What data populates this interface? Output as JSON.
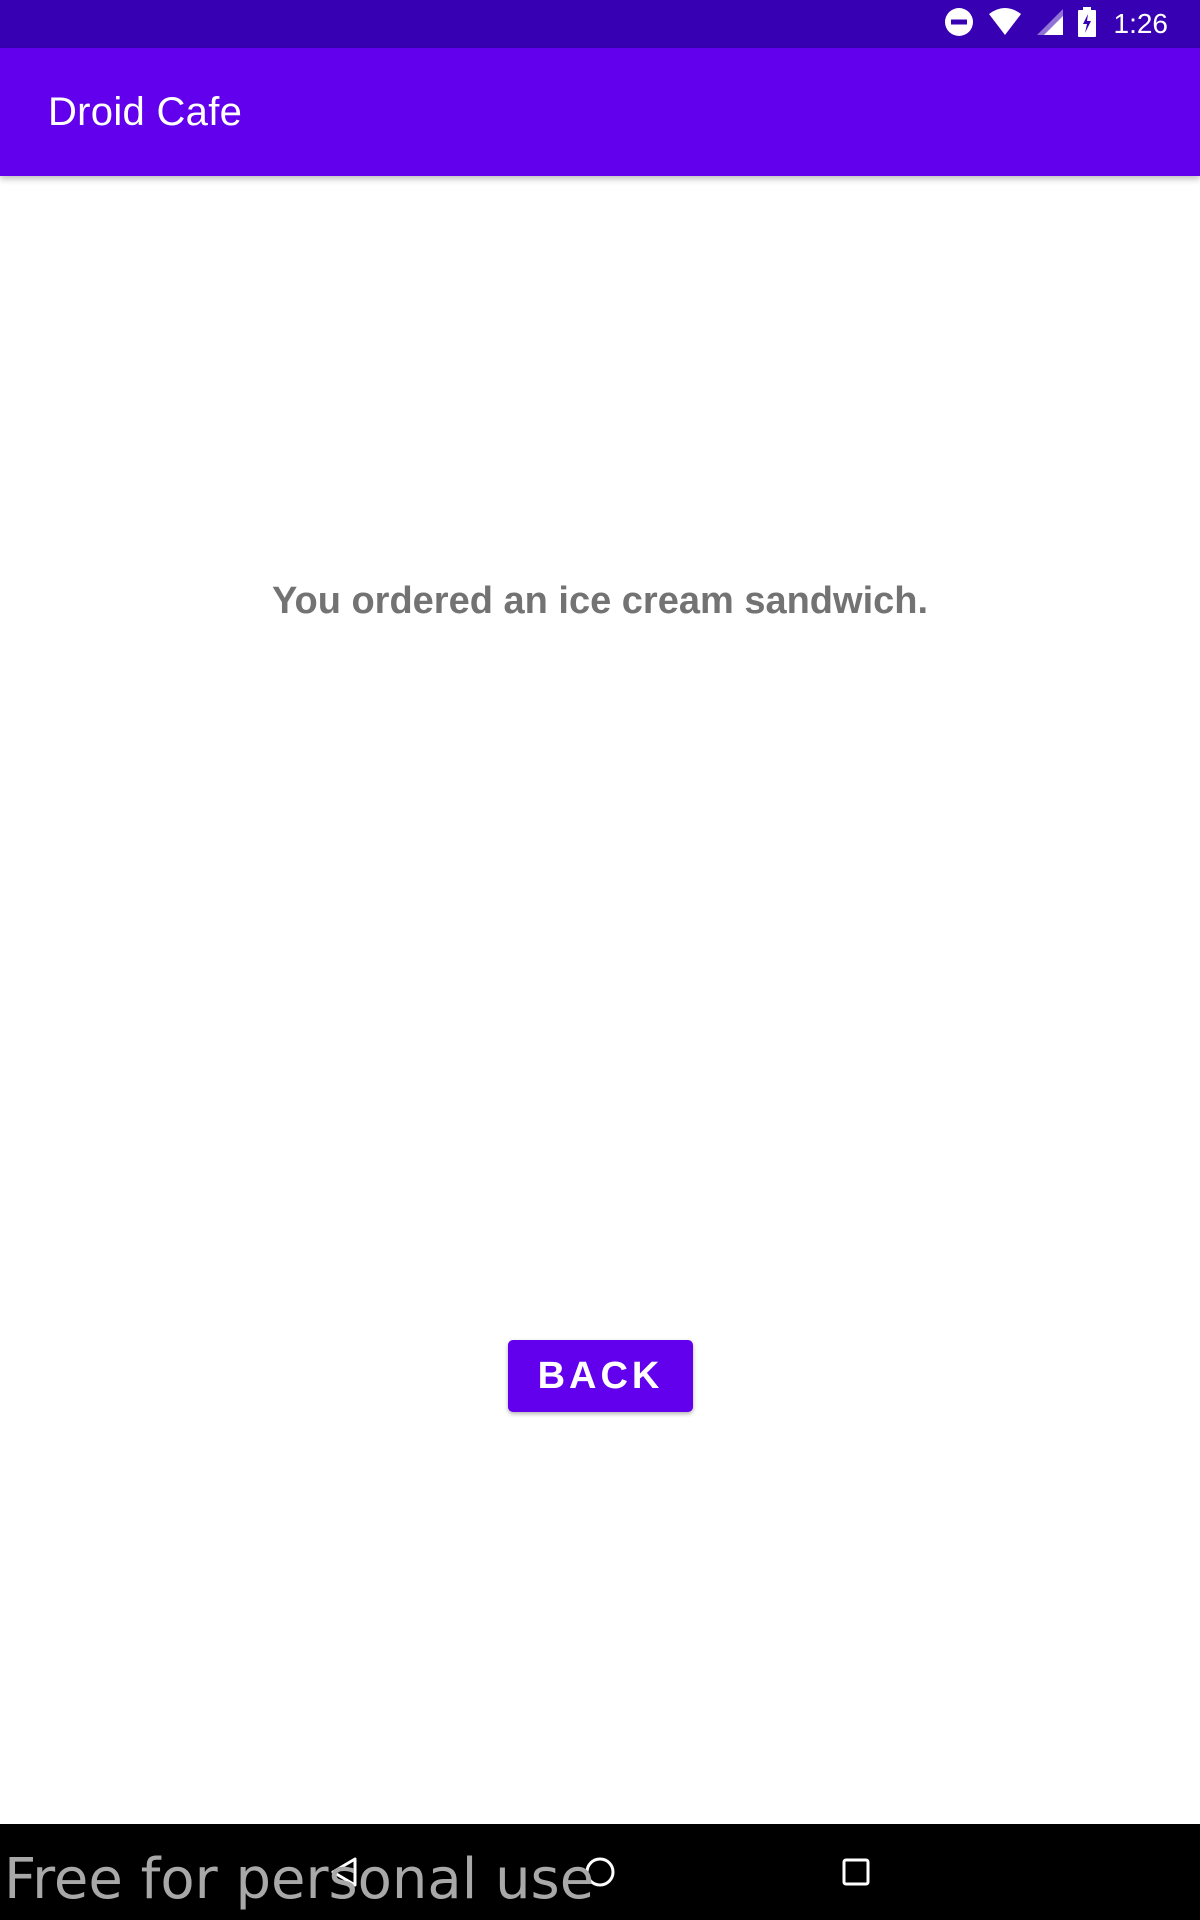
{
  "status_bar": {
    "time": "1:26",
    "icons": [
      "do-not-disturb-icon",
      "wifi-icon",
      "cell-signal-icon",
      "battery-charging-icon"
    ]
  },
  "app_bar": {
    "title": "Droid Cafe"
  },
  "main": {
    "message": "You ordered an ice cream sandwich.",
    "back_label": "BACK"
  },
  "nav_bar": {
    "buttons": [
      "back-nav-icon",
      "home-nav-icon",
      "recents-nav-icon"
    ]
  },
  "watermark": {
    "text": "Free for personal use"
  },
  "colors": {
    "status_bar": "#3700b3",
    "primary": "#6200ee",
    "message_text": "#737373"
  }
}
